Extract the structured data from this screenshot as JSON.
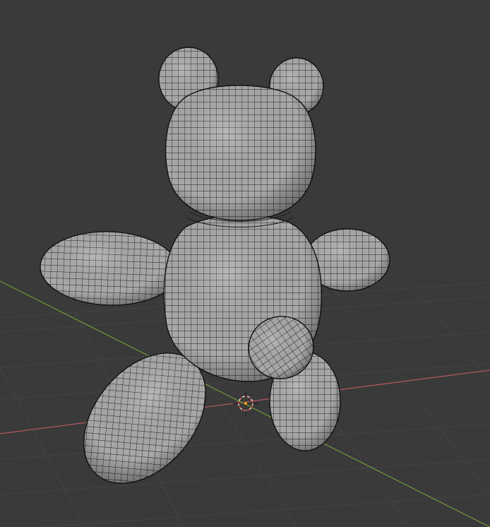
{
  "viewport": {
    "background_color": "#3a3a3a",
    "grid_color": "#444444",
    "x_axis_color": "#b5575f",
    "y_axis_color": "#6e9a3a",
    "mesh_fill_color": "#a9a9a9",
    "wire_color": "#1e1e1e",
    "origin_marker_color": "#f29a18",
    "cursor_color": "#e0e0e0",
    "cursor_accent_color": "#d33b3b",
    "object_icon": "3d-cursor-icon",
    "object_name": ""
  }
}
